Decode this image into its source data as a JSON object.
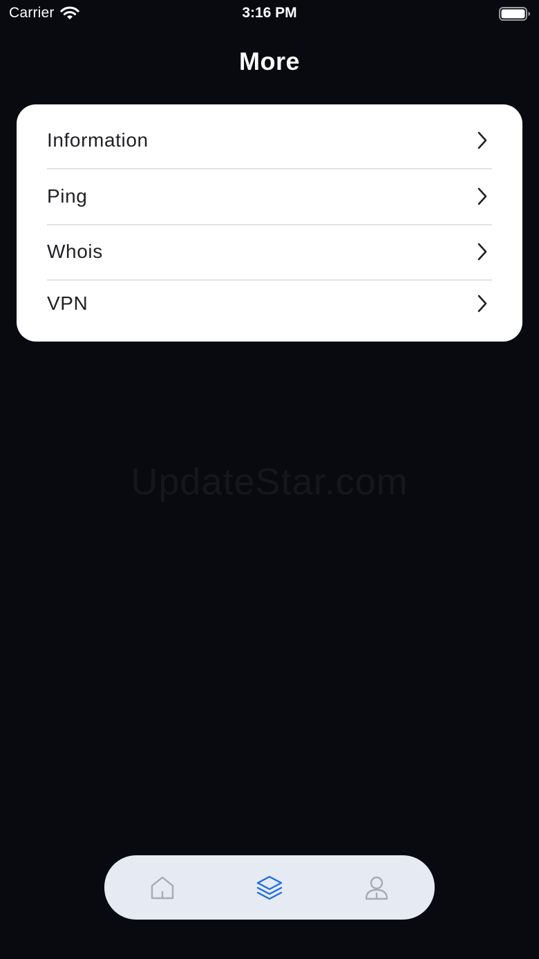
{
  "status_bar": {
    "carrier": "Carrier",
    "time": "3:16 PM",
    "icons": [
      "wifi-icon",
      "battery-icon"
    ]
  },
  "header": {
    "title": "More"
  },
  "menu": {
    "items": [
      {
        "label": "Information",
        "icon": "chevron-right-icon"
      },
      {
        "label": "Ping",
        "icon": "chevron-right-icon"
      },
      {
        "label": "Whois",
        "icon": "chevron-right-icon"
      },
      {
        "label": "VPN",
        "icon": "chevron-right-icon"
      }
    ]
  },
  "watermark": {
    "text": "UpdateStar.com"
  },
  "tab_bar": {
    "tabs": [
      {
        "icon": "home-icon",
        "active": false
      },
      {
        "icon": "layers-icon",
        "active": true
      },
      {
        "icon": "profile-icon",
        "active": false
      }
    ],
    "active_color": "#1e6fe0",
    "inactive_color": "#a6abb5",
    "background": "#e6eaf2"
  },
  "colors": {
    "background": "#080a10",
    "card": "#ffffff",
    "divider": "#e2e3e6",
    "menu_text": "#1f2024"
  }
}
